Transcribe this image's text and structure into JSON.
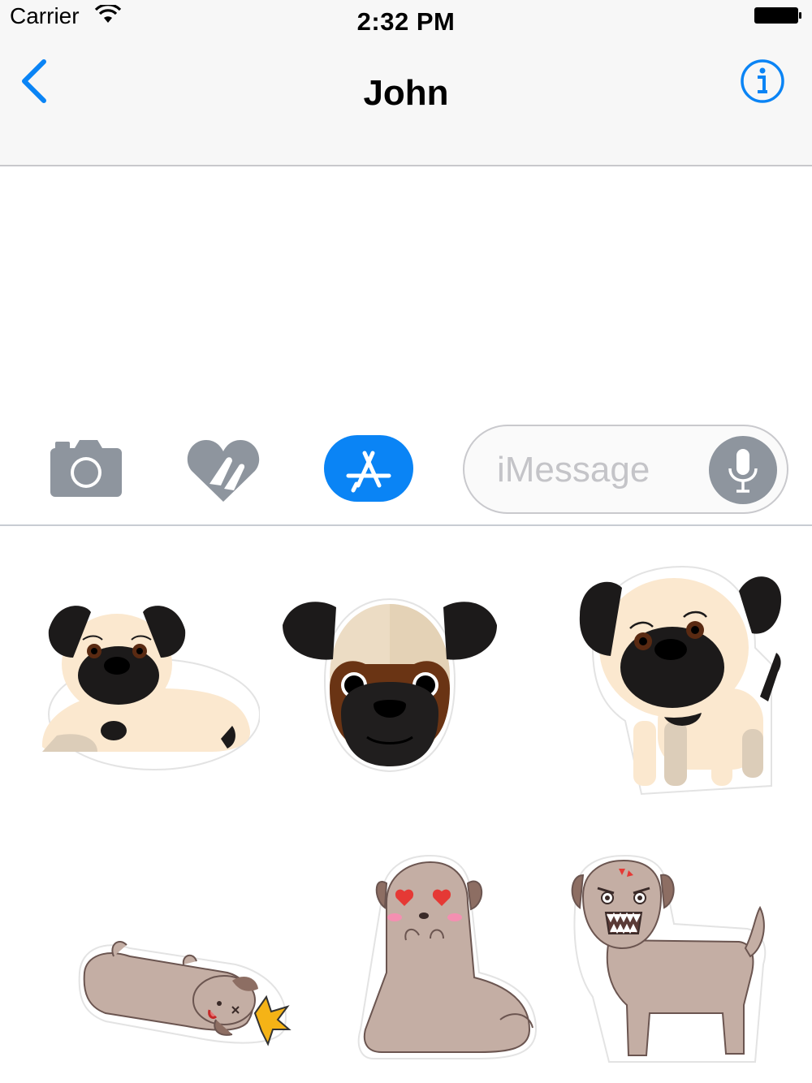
{
  "status_bar": {
    "carrier": "Carrier",
    "time": "2:32 PM",
    "icons": [
      "wifi-icon",
      "battery-icon"
    ]
  },
  "nav": {
    "title": "John",
    "back_icon": "chevron-left-icon",
    "info_icon": "info-icon"
  },
  "toolbar": {
    "buttons": [
      "camera-icon",
      "digital-touch-icon",
      "app-store-icon"
    ],
    "input_placeholder": "iMessage",
    "mic_icon": "microphone-icon"
  },
  "stickers": [
    {
      "name": "pug-lying-down"
    },
    {
      "name": "pug-face"
    },
    {
      "name": "pug-standing"
    },
    {
      "name": "dog-knocked-out"
    },
    {
      "name": "dog-heart-eyes"
    },
    {
      "name": "dog-angry"
    }
  ],
  "colors": {
    "accent": "#0a84f5",
    "bar_background": "#f7f7f7",
    "icon_gray": "#8e959e"
  }
}
